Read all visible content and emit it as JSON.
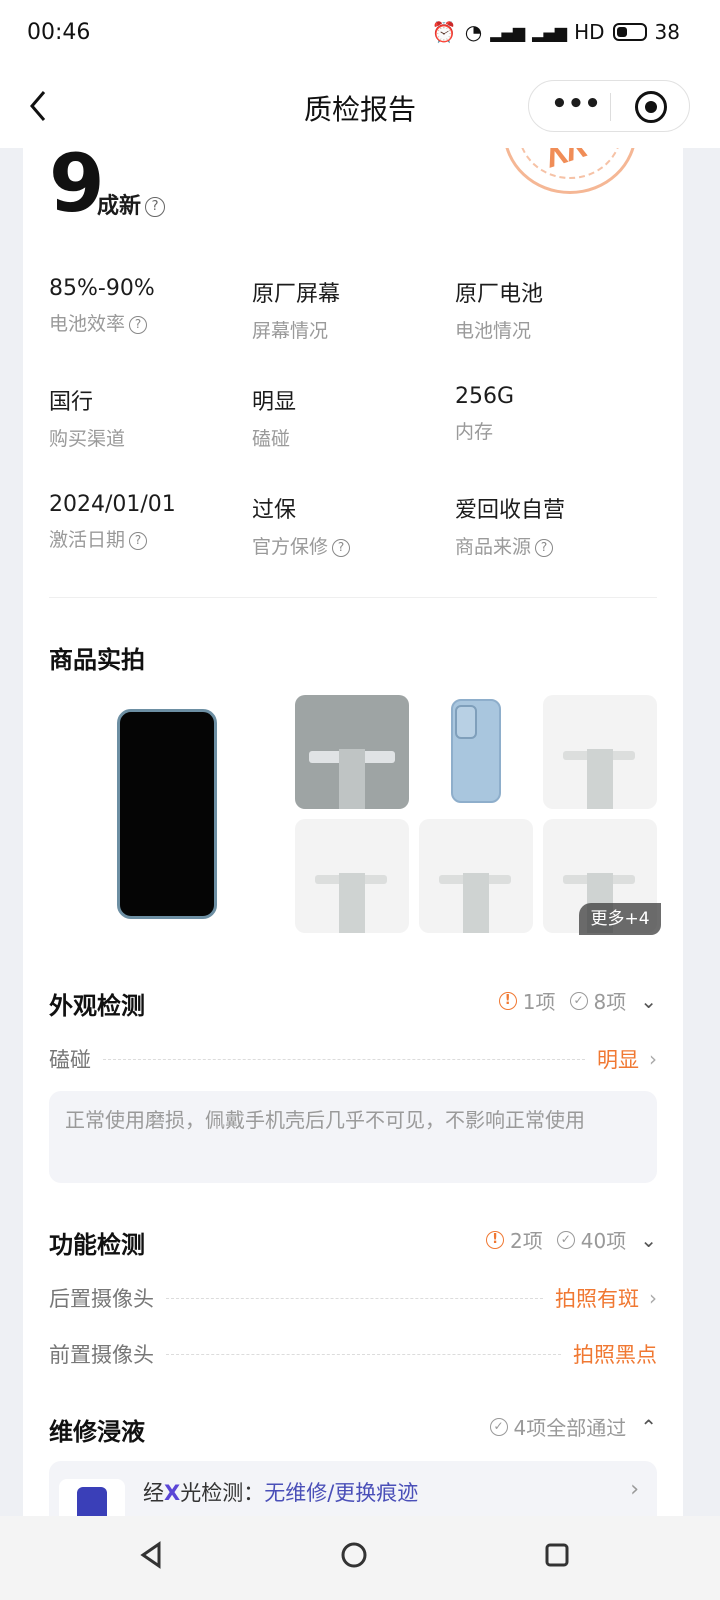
{
  "status_bar": {
    "time": "00:46",
    "hd": "HD",
    "battery": "38"
  },
  "nav": {
    "title": "质检报告"
  },
  "grade": {
    "number": "9",
    "label": "成新"
  },
  "specs": [
    {
      "value": "85%-90%",
      "key": "电池效率",
      "has_help": true
    },
    {
      "value": "原厂屏幕",
      "key": "屏幕情况",
      "has_help": false
    },
    {
      "value": "原厂电池",
      "key": "电池情况",
      "has_help": false
    },
    {
      "value": "国行",
      "key": "购买渠道",
      "has_help": false
    },
    {
      "value": "明显",
      "key": "磕碰",
      "has_help": false
    },
    {
      "value": "256G",
      "key": "内存",
      "has_help": false
    },
    {
      "value": "2024/01/01",
      "key": "激活日期",
      "has_help": true
    },
    {
      "value": "过保",
      "key": "官方保修",
      "has_help": true
    },
    {
      "value": "爱回收自营",
      "key": "商品来源",
      "has_help": true
    }
  ],
  "photos": {
    "title": "商品实拍",
    "more_label": "更多+4"
  },
  "appearance": {
    "title": "外观检测",
    "issues": "1项",
    "passed": "8项",
    "items": [
      {
        "name": "磕碰",
        "result": "明显"
      }
    ],
    "note": "正常使用磨损，佩戴手机壳后几乎不可见，不影响正常使用"
  },
  "function": {
    "title": "功能检测",
    "issues": "2项",
    "passed": "40项",
    "items": [
      {
        "name": "后置摄像头",
        "result": "拍照有斑"
      },
      {
        "name": "前置摄像头",
        "result": "拍照黑点"
      }
    ]
  },
  "repair": {
    "title": "维修浸液",
    "passed": "4项全部通过",
    "xray_prefix": "经",
    "xray_logo": "X",
    "xray_label": "光检测：",
    "xray_value": "无维修/更换痕迹"
  },
  "colors": {
    "accent": "#f07832",
    "xray": "#5b46d6"
  }
}
